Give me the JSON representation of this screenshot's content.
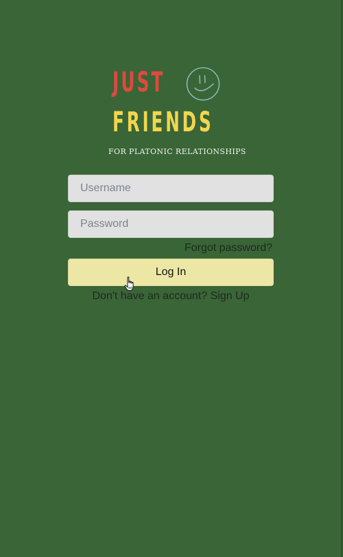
{
  "logo": {
    "line1": "JUST",
    "line2": "FRIENDS",
    "tagline": "FOR PLATONIC RELATIONSHIPS",
    "icon": "smiley-face-icon"
  },
  "form": {
    "username_placeholder": "Username",
    "username_value": "",
    "password_placeholder": "Password",
    "password_value": "",
    "forgot_password": "Forgot password?",
    "login_label": "Log In",
    "signup_prompt": "Don't have an account?",
    "signup_link": "Sign Up"
  },
  "colors": {
    "background": "#396537",
    "logo_just": "#de4a3d",
    "logo_friends": "#f2d64c",
    "button": "#ede7a6",
    "input": "#e1e1e1"
  }
}
